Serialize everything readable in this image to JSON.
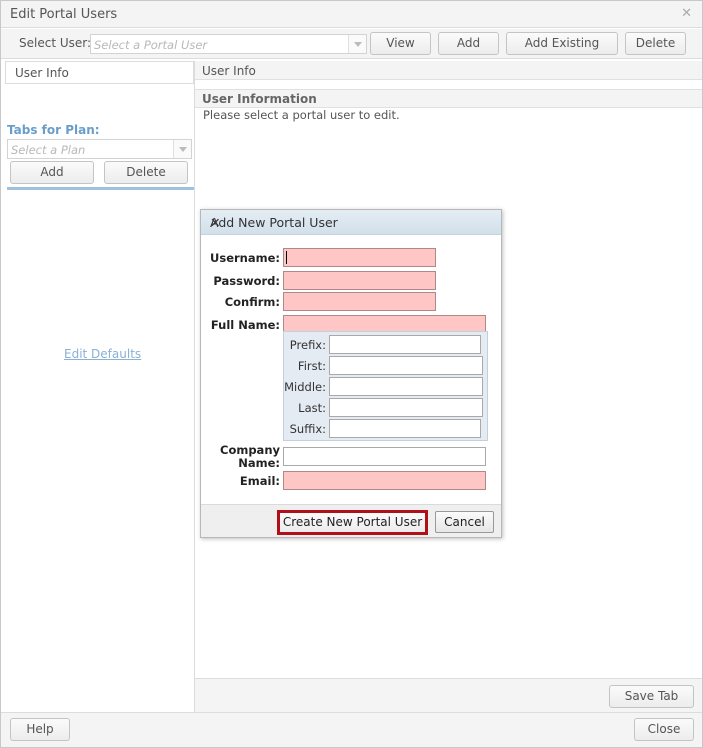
{
  "window": {
    "title": "Edit Portal Users"
  },
  "toolbar": {
    "select_user_label": "Select User:",
    "select_user_placeholder": "Select a Portal User",
    "view_label": "View",
    "add_label": "Add",
    "add_existing_label": "Add Existing",
    "delete_label": "Delete"
  },
  "left": {
    "tab_label": "User Info",
    "tabs_for_plan_label": "Tabs for Plan:",
    "plan_placeholder": "Select a Plan",
    "add_label": "Add",
    "delete_label": "Delete",
    "edit_defaults_label": "Edit Defaults"
  },
  "right": {
    "tab_label": "User Info",
    "header": "User Information",
    "message": "Please select a portal user to edit.",
    "save_tab_label": "Save Tab"
  },
  "footer": {
    "help_label": "Help",
    "close_label": "Close"
  },
  "dialog": {
    "title": "Add New Portal User",
    "username_label": "Username:",
    "password_label": "Password:",
    "confirm_label": "Confirm:",
    "fullname_label": "Full Name:",
    "prefix_label": "Prefix:",
    "first_label": "First:",
    "middle_label": "Middle:",
    "last_label": "Last:",
    "suffix_label": "Suffix:",
    "company_label_line1": "Company",
    "company_label_line2": "Name:",
    "email_label": "Email:",
    "create_label": "Create New Portal User",
    "cancel_label": "Cancel"
  },
  "colors": {
    "required_field_bg": "#ffc6c6",
    "highlight_border": "#b0101a",
    "link_color": "#8ab0d6",
    "accent_divider": "#9ec1de"
  },
  "icons": [
    "close-icon",
    "dropdown-arrow-icon"
  ]
}
